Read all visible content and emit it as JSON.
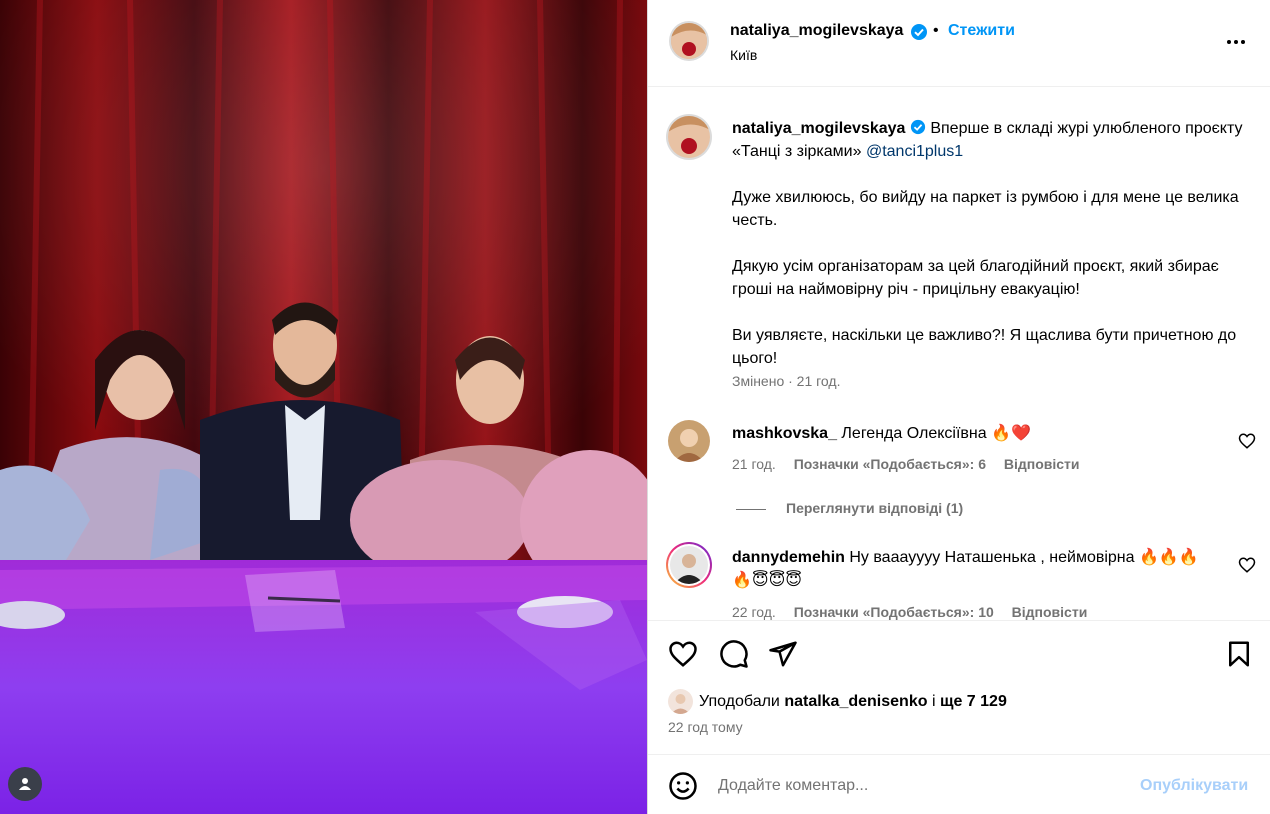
{
  "header": {
    "username": "nataliya_mogilevskaya",
    "dot": "•",
    "follow_label": "Стежити",
    "location": "Київ"
  },
  "caption": {
    "username": "nataliya_mogilevskaya",
    "line1": "Вперше в складі журі улюбленого проєкту «Танці з зірками»",
    "mention": "@tanci1plus1",
    "para2": "Дуже хвилююсь, бо вийду на паркет із румбою і для мене це велика честь.",
    "para3": "Дякую усім організаторам за цей благодійний проєкт, який збирає гроші на наймовірну річ - прицільну евакуацію!",
    "para4": "Ви уявляєте, наскільки це важливо?! Я щаслива бути причетною до цього!",
    "meta": "Змінено · 21 год."
  },
  "comments": [
    {
      "username": "mashkovska_",
      "text": "Легенда Олексіївна 🔥❤️",
      "time": "21 год.",
      "likes": "Позначки «Подобається»: 6",
      "reply": "Відповісти"
    },
    {
      "username": "dannydemehin",
      "text": "Ну вааауууу Наташенька , неймовірна 🔥🔥🔥🔥😇😇😇",
      "time": "22 год.",
      "likes": "Позначки «Подобається»: 10",
      "reply": "Відповісти"
    }
  ],
  "view_replies": "Переглянути відповіді (1)",
  "likes": {
    "prefix": "Уподобали",
    "user": "natalka_denisenko",
    "connector": "і",
    "rest": "ще 7 129"
  },
  "time_ago": "22 год тому",
  "comment_box": {
    "placeholder": "Додайте коментар...",
    "publish_label": "Опублікувати"
  },
  "colors": {
    "accent": "#0095f6",
    "publish_disabled": "#a8cffa",
    "muted": "#737373"
  }
}
